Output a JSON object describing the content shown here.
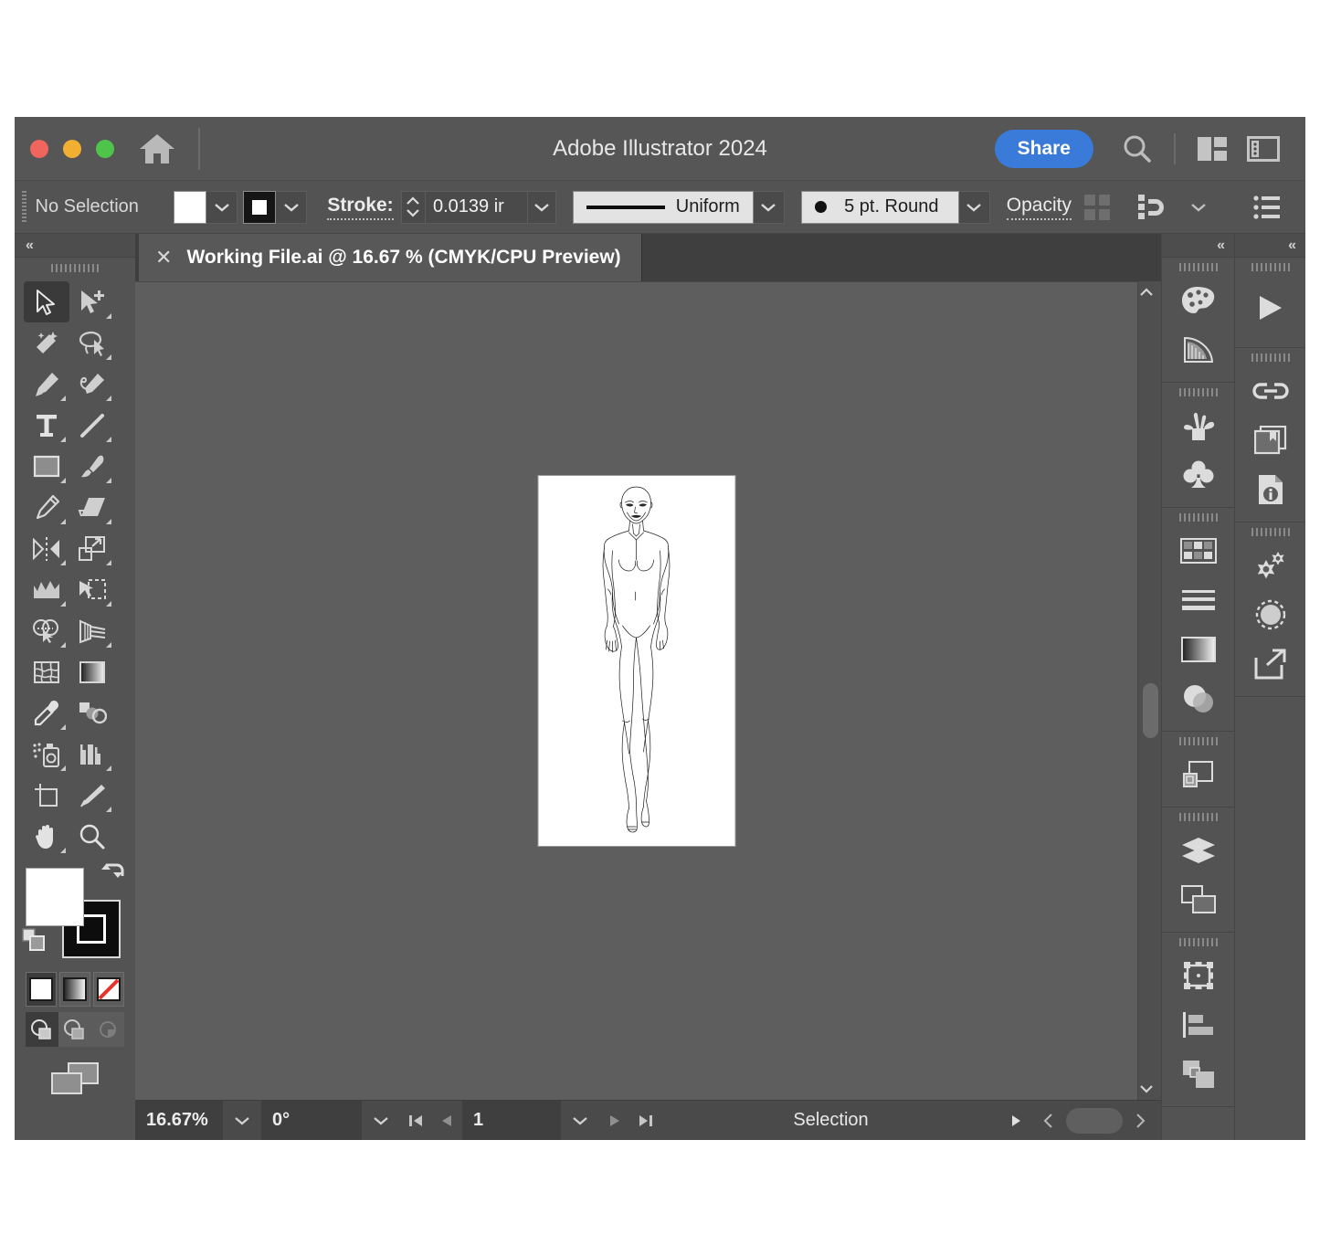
{
  "window": {
    "app_title": "Adobe Illustrator 2024",
    "traffic_lights": [
      "close-button",
      "minimize-button",
      "maximize-button"
    ],
    "home_icon": "home-icon",
    "share_label": "Share",
    "search_icon": "search-icon",
    "arrange_icon": "arrange-documents-icon",
    "workspace_icon": "workspace-switcher-icon"
  },
  "control_bar": {
    "selection_status": "No Selection",
    "fill_swatch": "fill-color-swatch",
    "fill_color": "#ffffff",
    "stroke_swatch": "stroke-color-swatch",
    "stroke_color": "#000000",
    "stroke_label": "Stroke:",
    "stroke_weight": "0.0139 ir",
    "profile_label": "Uniform",
    "brush_label": "5 pt. Round",
    "opacity_label": "Opacity",
    "align_icon": "align-objects-icon",
    "snap_icon": "snap-to-glyph-icon",
    "options_icon": "more-options-icon"
  },
  "document_tab": {
    "close_icon": "close-tab-icon",
    "title": "Working File.ai @ 16.67 % (CMYK/CPU Preview)"
  },
  "tools": {
    "collapse_icon": "collapse-panel-icon",
    "items": [
      {
        "name": "selection-tool",
        "selected": true,
        "corner": false
      },
      {
        "name": "direct-selection-tool",
        "selected": false,
        "corner": true
      },
      {
        "name": "magic-wand-tool",
        "selected": false,
        "corner": false
      },
      {
        "name": "lasso-tool",
        "selected": false,
        "corner": true
      },
      {
        "name": "pen-tool",
        "selected": false,
        "corner": true
      },
      {
        "name": "curvature-tool",
        "selected": false,
        "corner": true
      },
      {
        "name": "type-tool",
        "selected": false,
        "corner": true
      },
      {
        "name": "line-segment-tool",
        "selected": false,
        "corner": true
      },
      {
        "name": "rectangle-tool",
        "selected": false,
        "corner": true
      },
      {
        "name": "paintbrush-tool",
        "selected": false,
        "corner": true
      },
      {
        "name": "pencil-tool",
        "selected": false,
        "corner": true
      },
      {
        "name": "eraser-tool",
        "selected": false,
        "corner": true
      },
      {
        "name": "rotate-reflect-tool",
        "selected": false,
        "corner": true
      },
      {
        "name": "scale-tool",
        "selected": false,
        "corner": true
      },
      {
        "name": "width-warp-tool",
        "selected": false,
        "corner": true
      },
      {
        "name": "free-transform-tool",
        "selected": false,
        "corner": true
      },
      {
        "name": "shape-builder-tool",
        "selected": false,
        "corner": true
      },
      {
        "name": "perspective-grid-tool",
        "selected": false,
        "corner": true
      },
      {
        "name": "mesh-tool",
        "selected": false,
        "corner": false
      },
      {
        "name": "gradient-tool",
        "selected": false,
        "corner": false
      },
      {
        "name": "eyedropper-tool",
        "selected": false,
        "corner": true
      },
      {
        "name": "blend-tool",
        "selected": false,
        "corner": false
      },
      {
        "name": "symbol-sprayer-tool",
        "selected": false,
        "corner": true
      },
      {
        "name": "column-graph-tool",
        "selected": false,
        "corner": true
      },
      {
        "name": "artboard-tool",
        "selected": false,
        "corner": false
      },
      {
        "name": "slice-tool",
        "selected": false,
        "corner": true
      },
      {
        "name": "hand-tool",
        "selected": false,
        "corner": true
      },
      {
        "name": "zoom-tool",
        "selected": false,
        "corner": false
      }
    ],
    "fill_swatch": "fill-color-large-swatch",
    "stroke_swatch": "stroke-color-large-swatch",
    "swap_icon": "swap-fill-stroke-icon",
    "defaults_icon": "default-fill-stroke-icon",
    "color_modes": [
      {
        "name": "color-mode-button",
        "active": true
      },
      {
        "name": "gradient-mode-button",
        "active": false
      },
      {
        "name": "none-mode-button",
        "active": false
      }
    ],
    "draw_modes": [
      {
        "name": "draw-normal-button",
        "active": true
      },
      {
        "name": "draw-behind-button",
        "active": false
      },
      {
        "name": "draw-inside-button",
        "active": false
      }
    ],
    "screen_mode_icon": "screen-mode-icon"
  },
  "panels_primary": {
    "collapse_icon": "collapse-panel-icon",
    "groups": [
      {
        "items": [
          {
            "name": "color-panel-icon"
          },
          {
            "name": "color-guide-panel-icon"
          }
        ]
      },
      {
        "items": [
          {
            "name": "brushes-panel-icon"
          },
          {
            "name": "symbols-panel-icon"
          }
        ]
      },
      {
        "items": [
          {
            "name": "swatches-panel-icon"
          },
          {
            "name": "stroke-panel-icon"
          },
          {
            "name": "gradient-panel-icon"
          },
          {
            "name": "transparency-panel-icon"
          }
        ]
      },
      {
        "items": [
          {
            "name": "pathfinder-panel-icon"
          }
        ]
      },
      {
        "items": [
          {
            "name": "layers-panel-icon"
          },
          {
            "name": "artboards-panel-icon"
          }
        ]
      },
      {
        "items": [
          {
            "name": "transform-panel-icon"
          },
          {
            "name": "align-panel-icon"
          },
          {
            "name": "appearance-panel-icon"
          }
        ]
      }
    ]
  },
  "panels_secondary": {
    "collapse_icon": "collapse-panel-icon",
    "groups": [
      {
        "items": [
          {
            "name": "actions-panel-icon"
          }
        ]
      },
      {
        "items": [
          {
            "name": "links-panel-icon"
          },
          {
            "name": "libraries-panel-icon"
          },
          {
            "name": "document-info-panel-icon"
          }
        ]
      },
      {
        "items": [
          {
            "name": "graphic-styles-panel-icon"
          },
          {
            "name": "image-trace-panel-icon"
          },
          {
            "name": "asset-export-panel-icon"
          }
        ]
      }
    ]
  },
  "status_bar": {
    "zoom_level": "16.67%",
    "zoom_caret": "zoom-dropdown-icon",
    "rotation": "0°",
    "rotation_caret": "rotation-dropdown-icon",
    "first_artboard_icon": "first-artboard-icon",
    "prev_artboard_icon": "previous-artboard-icon",
    "artboard_number": "1",
    "artboard_caret": "artboard-dropdown-icon",
    "next_artboard_icon": "next-artboard-icon",
    "last_artboard_icon": "last-artboard-icon",
    "status_text": "Selection",
    "status_menu_icon": "status-menu-icon",
    "scroll_left_icon": "scroll-left-icon",
    "scroll_thumb": "horizontal-scroll-thumb",
    "scroll_right_icon": "scroll-right-icon"
  },
  "canvas": {
    "background_color": "#5e5e5e",
    "artboard_color": "#ffffff",
    "artwork_name": "fashion-croquis-figure",
    "scroll_up_icon": "scroll-up-icon",
    "scroll_down_icon": "scroll-down-icon",
    "scroll_thumb": "vertical-scroll-thumb"
  }
}
